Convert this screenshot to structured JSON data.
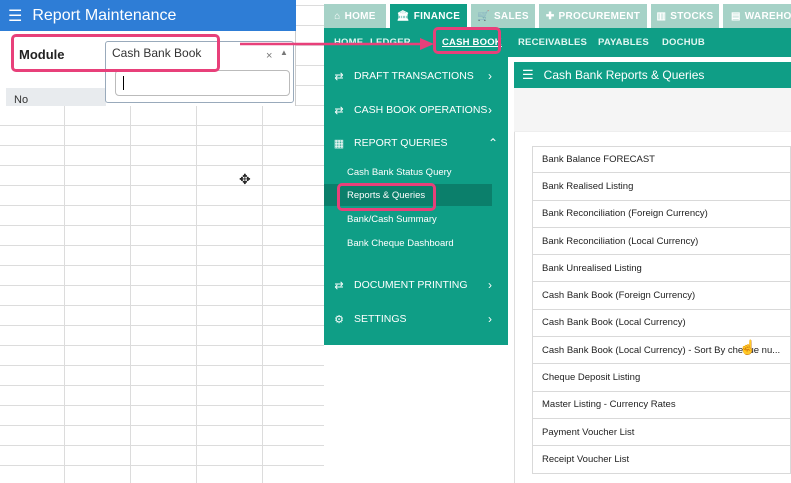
{
  "report_maintenance": {
    "title": "Report Maintenance",
    "module_label": "Module",
    "module_value": "Cash Bank Book",
    "clear_glyph": "×",
    "caret_glyph": "▲",
    "no_header": "No",
    "cursor_glyph": "✥"
  },
  "topnav": {
    "tabs": [
      {
        "label": "HOME",
        "icon": "⌂"
      },
      {
        "label": "FINANCE",
        "icon": "🏛"
      },
      {
        "label": "SALES",
        "icon": "🛒"
      },
      {
        "label": "PROCUREMENT",
        "icon": "✚"
      },
      {
        "label": "STOCKS",
        "icon": "▥"
      },
      {
        "label": "WAREHO",
        "icon": "▤"
      }
    ]
  },
  "subnav": {
    "items": [
      "HOME",
      "LEDGER",
      "CASH BOOK",
      "RECEIVABLES",
      "PAYABLES",
      "DOCHUB"
    ]
  },
  "sidemenu": {
    "sections": [
      {
        "label": "DRAFT TRANSACTIONS",
        "icon": "⇄",
        "chevron": "›"
      },
      {
        "label": "CASH BOOK OPERATIONS",
        "icon": "⇄",
        "chevron": "›"
      },
      {
        "label": "REPORT QUERIES",
        "icon": "▦",
        "chevron": "⌃"
      },
      {
        "label": "DOCUMENT PRINTING",
        "icon": "⇄",
        "chevron": "›"
      },
      {
        "label": "SETTINGS",
        "icon": "⚙",
        "chevron": "›"
      }
    ],
    "report_items": [
      "Cash Bank Status Query",
      "Reports & Queries",
      "Bank/Cash Summary",
      "Bank Cheque Dashboard"
    ]
  },
  "right_panel": {
    "title": "Cash Bank Reports & Queries",
    "items": [
      "Bank Balance FORECAST",
      "Bank Realised Listing",
      "Bank Reconciliation (Foreign Currency)",
      "Bank Reconciliation (Local Currency)",
      "Bank Unrealised Listing",
      "Cash Bank Book (Foreign Currency)",
      "Cash Bank Book (Local Currency)",
      "Cash Bank Book (Local Currency) - Sort By cheque nu...",
      "Cheque Deposit Listing",
      "Master Listing - Currency Rates",
      "Payment Voucher List",
      "Receipt Voucher List"
    ]
  },
  "colors": {
    "brand_teal": "#0f9e86",
    "highlight_pink": "#e8407a",
    "header_blue": "#2e7dd6"
  }
}
